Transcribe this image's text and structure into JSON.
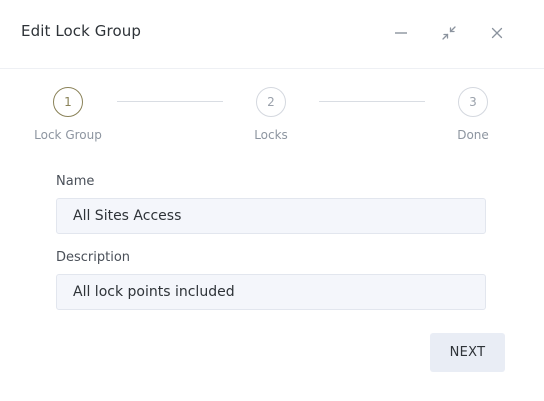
{
  "dialog": {
    "title": "Edit Lock Group",
    "controls": {
      "minimize_icon": "minimize-icon",
      "collapse_icon": "collapse-icon",
      "close_icon": "close-icon"
    }
  },
  "stepper": {
    "current_step": 1,
    "steps": [
      {
        "number": "1",
        "label": "Lock Group",
        "active": true
      },
      {
        "number": "2",
        "label": "Locks",
        "active": false
      },
      {
        "number": "3",
        "label": "Done",
        "active": false
      }
    ]
  },
  "form": {
    "name": {
      "label": "Name",
      "value": "All Sites Access"
    },
    "description": {
      "label": "Description",
      "value": "All lock points included"
    }
  },
  "actions": {
    "next_label": "NEXT"
  },
  "colors": {
    "active_step": "#8a8258",
    "input_background": "#f4f6fb",
    "button_background": "#e9edf5"
  }
}
